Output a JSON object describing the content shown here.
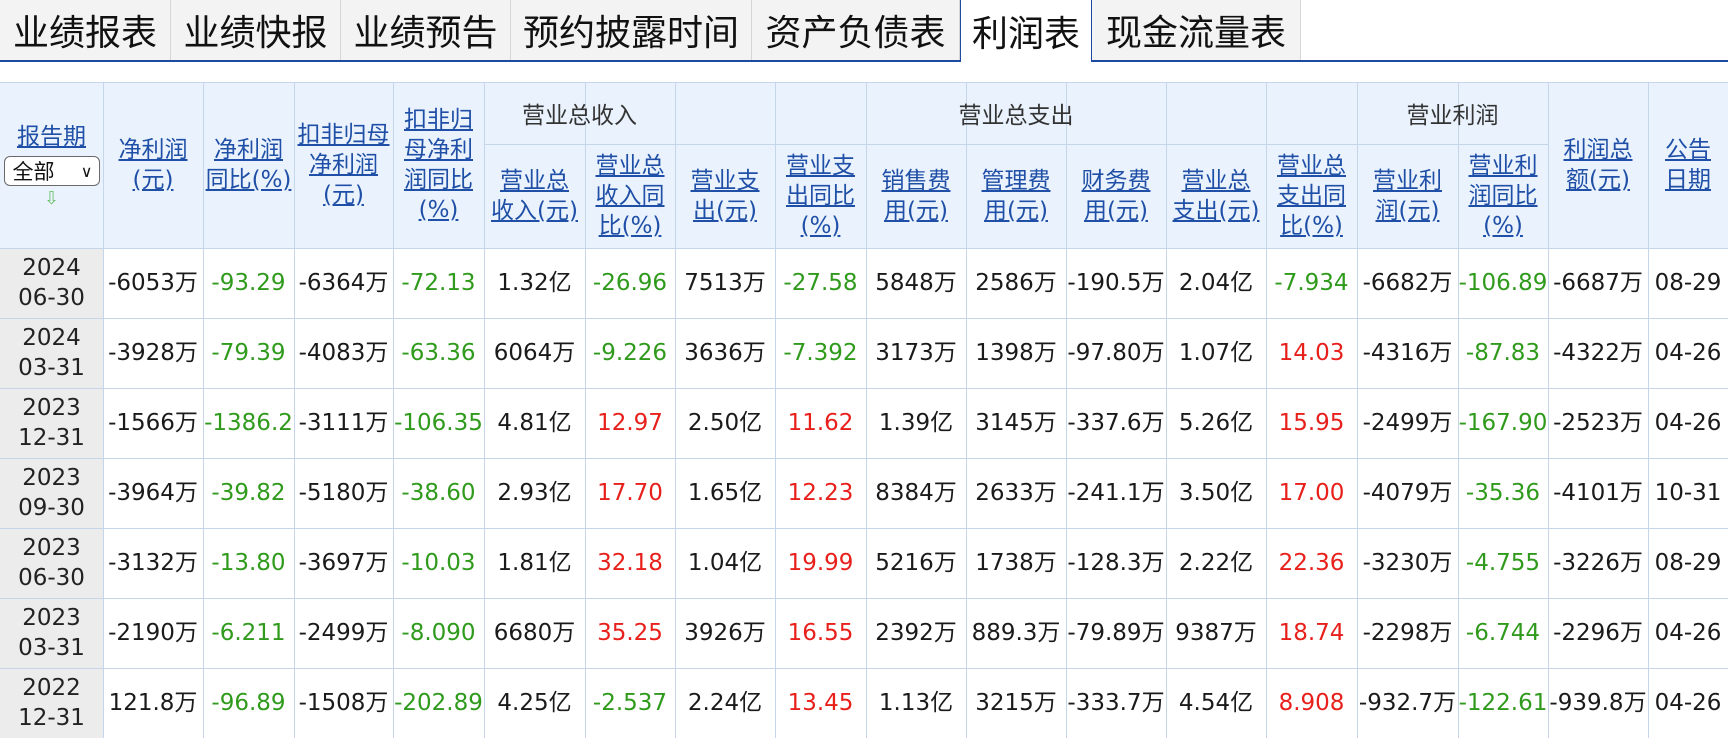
{
  "tabs": [
    {
      "label": "业绩报表",
      "active": false
    },
    {
      "label": "业绩快报",
      "active": false
    },
    {
      "label": "业绩预告",
      "active": false
    },
    {
      "label": "预约披露时间",
      "active": false
    },
    {
      "label": "资产负债表",
      "active": false
    },
    {
      "label": "利润表",
      "active": true
    },
    {
      "label": "现金流量表",
      "active": false
    }
  ],
  "table": {
    "group_headers": {
      "revenue": "营业总收入",
      "expense": "营业总支出",
      "op_profit": "营业利润"
    },
    "period_header": {
      "label": "报告期",
      "select_value": "全部"
    },
    "columns": [
      "净利润\n(元)",
      "净利润\n同比(%)",
      "扣非归母\n净利润\n(元)",
      "扣非归\n母净利\n润同比\n(%)",
      "营业总\n收入(元)",
      "营业总\n收入同\n比(%)",
      "营业支\n出(元)",
      "营业支\n出同比\n(%)",
      "销售费\n用(元)",
      "管理费\n用(元)",
      "财务费\n用(元)",
      "营业总\n支出(元)",
      "营业总\n支出同\n比(%)",
      "营业利\n润(元)",
      "营业利\n润同比\n(%)",
      "利润总\n额(元)",
      "公告\n日期"
    ],
    "colors": {
      "positive": "#e8201c",
      "negative": "#2f9a1c",
      "header_bg": "#eaf3fd",
      "link": "#1f4fa6"
    },
    "rows": [
      {
        "period": "2024\n06-30",
        "values": [
          "-6053万",
          "-93.29",
          "-6364万",
          "-72.13",
          "1.32亿",
          "-26.96",
          "7513万",
          "-27.58",
          "5848万",
          "2586万",
          "-190.5万",
          "2.04亿",
          "-7.934",
          "-6682万",
          "-106.89",
          "-6687万",
          "08-29"
        ]
      },
      {
        "period": "2024\n03-31",
        "values": [
          "-3928万",
          "-79.39",
          "-4083万",
          "-63.36",
          "6064万",
          "-9.226",
          "3636万",
          "-7.392",
          "3173万",
          "1398万",
          "-97.80万",
          "1.07亿",
          "14.03",
          "-4316万",
          "-87.83",
          "-4322万",
          "04-26"
        ]
      },
      {
        "period": "2023\n12-31",
        "values": [
          "-1566万",
          "-1386.2",
          "-3111万",
          "-106.35",
          "4.81亿",
          "12.97",
          "2.50亿",
          "11.62",
          "1.39亿",
          "3145万",
          "-337.6万",
          "5.26亿",
          "15.95",
          "-2499万",
          "-167.90",
          "-2523万",
          "04-26"
        ]
      },
      {
        "period": "2023\n09-30",
        "values": [
          "-3964万",
          "-39.82",
          "-5180万",
          "-38.60",
          "2.93亿",
          "17.70",
          "1.65亿",
          "12.23",
          "8384万",
          "2633万",
          "-241.1万",
          "3.50亿",
          "17.00",
          "-4079万",
          "-35.36",
          "-4101万",
          "10-31"
        ]
      },
      {
        "period": "2023\n06-30",
        "values": [
          "-3132万",
          "-13.80",
          "-3697万",
          "-10.03",
          "1.81亿",
          "32.18",
          "1.04亿",
          "19.99",
          "5216万",
          "1738万",
          "-128.3万",
          "2.22亿",
          "22.36",
          "-3230万",
          "-4.755",
          "-3226万",
          "08-29"
        ]
      },
      {
        "period": "2023\n03-31",
        "values": [
          "-2190万",
          "-6.211",
          "-2499万",
          "-8.090",
          "6680万",
          "35.25",
          "3926万",
          "16.55",
          "2392万",
          "889.3万",
          "-79.89万",
          "9387万",
          "18.74",
          "-2298万",
          "-6.744",
          "-2296万",
          "04-26"
        ]
      },
      {
        "period": "2022\n12-31",
        "values": [
          "121.8万",
          "-96.89",
          "-1508万",
          "-202.89",
          "4.25亿",
          "-2.537",
          "2.24亿",
          "13.45",
          "1.13亿",
          "3215万",
          "-333.7万",
          "4.54亿",
          "8.908",
          "-932.7万",
          "-122.61",
          "-939.8万",
          "04-26"
        ]
      }
    ]
  }
}
